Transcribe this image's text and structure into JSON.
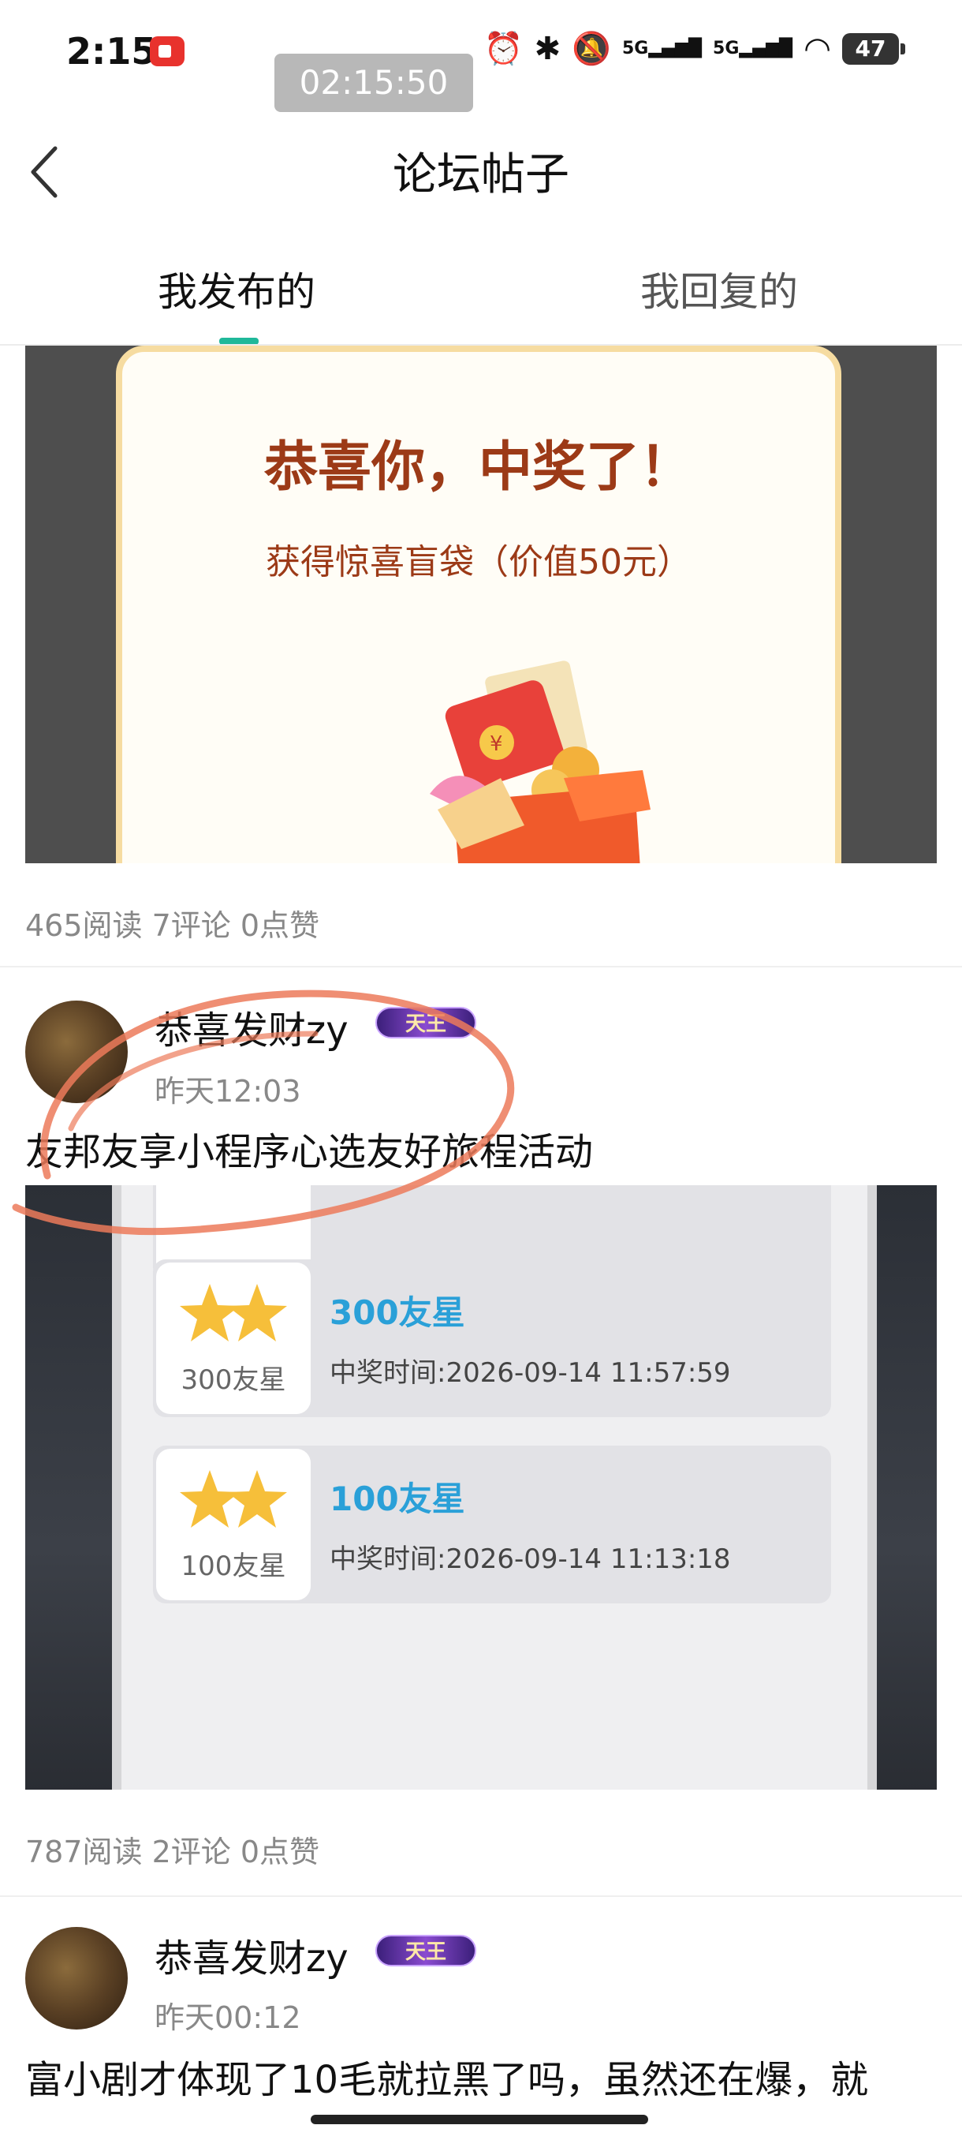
{
  "status_bar": {
    "time": "2:15",
    "recording_timer": "02:15:50",
    "network_1": "5G",
    "network_2": "5G",
    "battery": "47"
  },
  "header": {
    "title": "论坛帖子"
  },
  "tabs": [
    {
      "label": "我发布的",
      "active": true
    },
    {
      "label": "我回复的",
      "active": false
    }
  ],
  "posts": [
    {
      "image_title": "恭喜你，中奖了！",
      "image_subtitle": "获得惊喜盲袋（价值50元）",
      "stats": "465阅读 7评论 0点赞"
    },
    {
      "author": "恭喜发财zy",
      "badge": "天王",
      "time": "昨天12:03",
      "title": "友邦友享小程序心选友好旅程活动",
      "prizes": [
        {
          "label": "300友星",
          "name": "300友星",
          "time": "中奖时间:2026-09-14 11:57:59"
        },
        {
          "label": "100友星",
          "name": "100友星",
          "time": "中奖时间:2026-09-14 11:13:18"
        }
      ],
      "stats": "787阅读 2评论 0点赞"
    },
    {
      "author": "恭喜发财zy",
      "badge": "天王",
      "time": "昨天00:12",
      "title": "富小剧才体现了10毛就拉黑了吗，虽然还在爆，就"
    }
  ],
  "colors": {
    "accent": "#1fb89a",
    "prize_blue": "#2aa0d8",
    "title_red": "#9c3a17"
  }
}
